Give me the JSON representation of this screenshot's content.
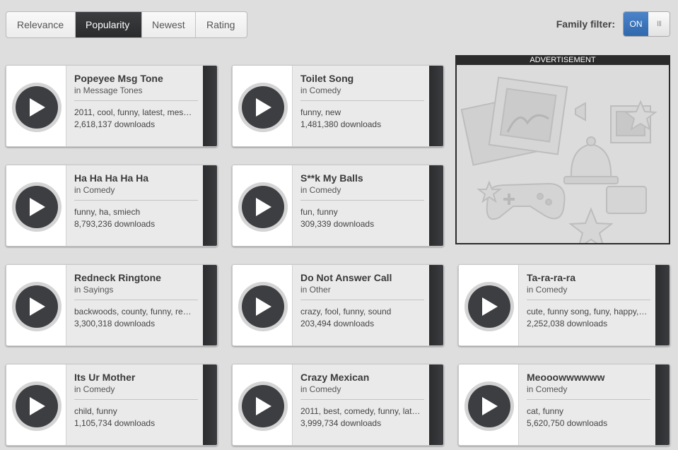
{
  "sort": {
    "tabs": [
      "Relevance",
      "Popularity",
      "Newest",
      "Rating"
    ],
    "active": "Popularity"
  },
  "family_filter": {
    "label": "Family filter:",
    "on_label": "ON",
    "off_label": "III"
  },
  "ad": {
    "label": "ADVERTISEMENT"
  },
  "cards": [
    {
      "title": "Popeyee Msg Tone",
      "category": "in Message Tones",
      "tags": "2011, cool, funny, latest, mes…",
      "downloads": "2,618,137 downloads"
    },
    {
      "title": "Toilet Song",
      "category": "in Comedy",
      "tags": "funny, new",
      "downloads": "1,481,380 downloads"
    },
    {
      "title": "Ha Ha Ha Ha Ha",
      "category": "in Comedy",
      "tags": "funny, ha, smiech",
      "downloads": "8,793,236 downloads"
    },
    {
      "title": "S**k My Balls",
      "category": "in Comedy",
      "tags": "fun, funny",
      "downloads": "309,339 downloads"
    },
    {
      "title": "Redneck Ringtone",
      "category": "in Sayings",
      "tags": "backwoods, county, funny, re…",
      "downloads": "3,300,318 downloads"
    },
    {
      "title": "Do Not Answer Call",
      "category": "in Other",
      "tags": "crazy, fool, funny, sound",
      "downloads": "203,494 downloads"
    },
    {
      "title": "Ta-ra-ra-ra",
      "category": "in Comedy",
      "tags": "cute, funny song, funy, happy,…",
      "downloads": "2,252,038 downloads"
    },
    {
      "title": "Its Ur Mother",
      "category": "in Comedy",
      "tags": "child, funny",
      "downloads": "1,105,734 downloads"
    },
    {
      "title": "Crazy Mexican",
      "category": "in Comedy",
      "tags": "2011, best, comedy, funny, lat…",
      "downloads": "3,999,734 downloads"
    },
    {
      "title": "Meooowwwwww",
      "category": "in Comedy",
      "tags": "cat, funny",
      "downloads": "5,620,750 downloads"
    }
  ]
}
